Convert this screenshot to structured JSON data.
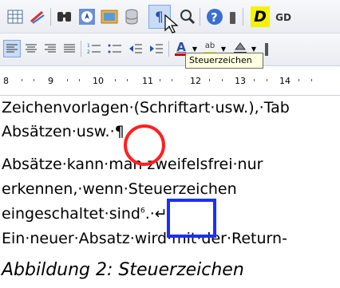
{
  "toolbar1": {
    "buttons": [
      "table-icon",
      "draw-icon",
      "find-icon",
      "navigator-icon",
      "gallery-icon",
      "datasource-icon",
      "formatting-marks-icon",
      "zoom-icon",
      "help-icon",
      "more-icon"
    ],
    "d_label": "D",
    "gd_label": "GD"
  },
  "toolbar2": {
    "buttons": [
      "align-left-icon",
      "align-center-icon",
      "align-right-icon",
      "justify-icon",
      "numbering-icon",
      "bullets-icon",
      "decrease-indent-icon",
      "increase-indent-icon",
      "font-color-icon",
      "highlight-icon",
      "background-color-icon"
    ],
    "font_color_label": "A",
    "highlight_label": "ab"
  },
  "tooltip": "Steuerzeichen",
  "ruler": {
    "numbers": [
      "8",
      "9",
      "10",
      "11",
      "12",
      "13",
      "14"
    ]
  },
  "document": {
    "line1": "Zeichenvorlagen·(Schriftart·usw.),·Tab",
    "line2": "Absätzen·usw.·¶",
    "line3": "Absätze·kann·man·zweifelsfrei·nur",
    "line4": "erkennen,·wenn·Steuerzeichen",
    "line5_a": "eingeschaltet·sind",
    "line5_sup": "6",
    "line5_b": ".·↵",
    "line6": "Ein·neuer·Absatz·wird·mit·der·Return-"
  },
  "caption": "Abbildung 2: Steuerzeichen",
  "colors": {
    "highlight_circle": "#ff2020",
    "highlight_box": "#1a2fff",
    "tooltip_bg": "#ffffe1"
  }
}
